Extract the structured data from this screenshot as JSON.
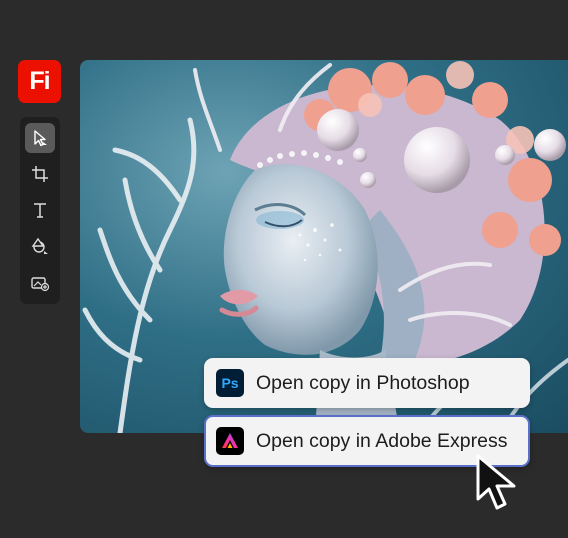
{
  "app": {
    "logo_text": "Fi",
    "brand_color": "#eb1000"
  },
  "toolbar": {
    "tools": [
      {
        "icon": "select-arrow-icon",
        "active": true
      },
      {
        "icon": "crop-icon",
        "active": false
      },
      {
        "icon": "text-icon",
        "active": false
      },
      {
        "icon": "shapes-icon",
        "active": false
      },
      {
        "icon": "add-image-icon",
        "active": false
      }
    ]
  },
  "context_menu": {
    "items": [
      {
        "label": "Open copy in Photoshop",
        "icon": "photoshop-icon",
        "icon_text": "Ps"
      },
      {
        "label": "Open copy in Adobe Express",
        "icon": "adobe-express-icon",
        "highlighted": true
      }
    ]
  },
  "colors": {
    "background": "#2b2b2b",
    "toolbar": "#1f1f1f",
    "menu": "#f3f3f3",
    "focus_border": "#5a70c8"
  }
}
